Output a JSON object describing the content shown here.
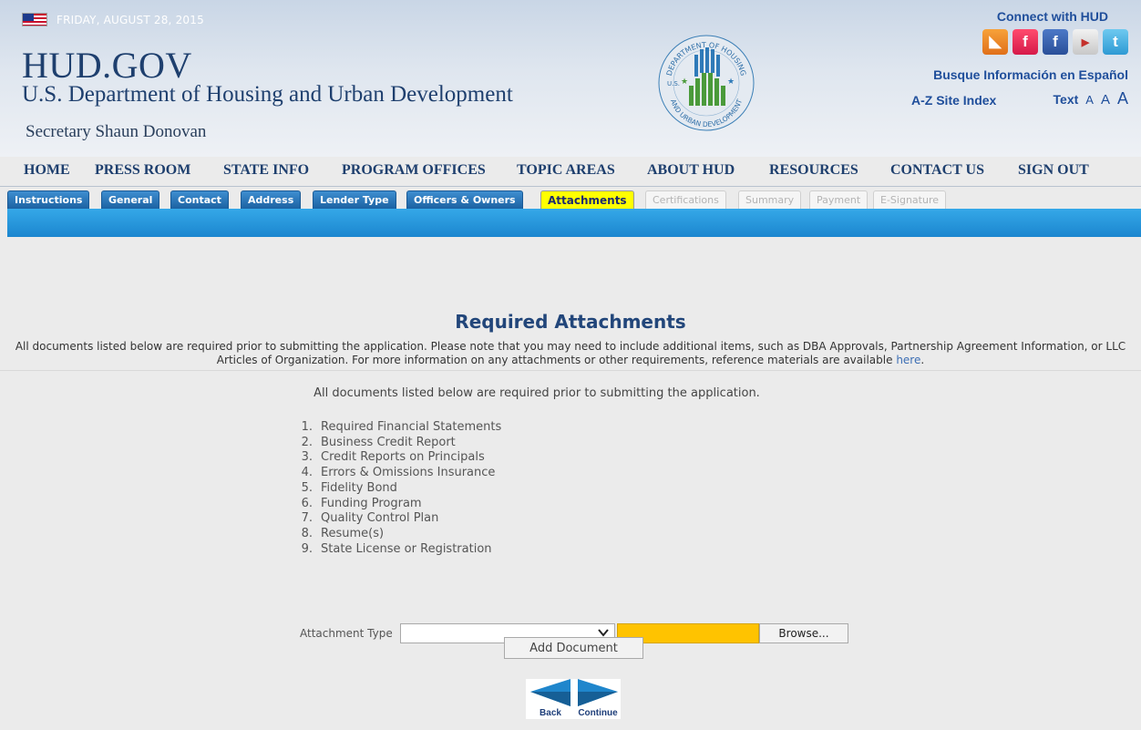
{
  "header": {
    "date": "FRIDAY, AUGUST 28, 2015",
    "site": "HUD.GOV",
    "department": "U.S. Department of Housing and Urban Development",
    "secretary": "Secretary Shaun Donovan",
    "connect": "Connect with HUD",
    "spanish": "Busque Información en Español",
    "az_index": "A-Z Site Index",
    "text_label": "Text",
    "text_sizes": [
      "A",
      "A",
      "A"
    ],
    "seal_top_text": "DEPARTMENT OF HOUSING",
    "seal_bottom_text": "AND URBAN DEVELOPMENT",
    "seal_left_text": "U.S."
  },
  "nav": [
    "HOME",
    "PRESS ROOM",
    "STATE INFO",
    "PROGRAM OFFICES",
    "TOPIC AREAS",
    "ABOUT HUD",
    "RESOURCES",
    "CONTACT US",
    "SIGN OUT"
  ],
  "tabs": [
    {
      "label": "Instructions",
      "state": "normal"
    },
    {
      "label": "General",
      "state": "normal"
    },
    {
      "label": "Contact",
      "state": "normal"
    },
    {
      "label": "Address",
      "state": "normal"
    },
    {
      "label": "Lender Type",
      "state": "normal"
    },
    {
      "label": "Officers & Owners",
      "state": "normal"
    },
    {
      "label": "Attachments",
      "state": "active"
    },
    {
      "label": "Certifications",
      "state": "disabled"
    },
    {
      "label": "Summary",
      "state": "disabled"
    },
    {
      "label": "Payment",
      "state": "disabled"
    },
    {
      "label": "E-Signature",
      "state": "disabled"
    }
  ],
  "main": {
    "title": "Required Attachments",
    "intro": "All documents listed below are required prior to submitting the application. Please note that you may need to include additional items, such as DBA Approvals, Partnership Agreement Information, or LLC Articles of Organization. For more information on any attachments or other requirements, reference materials are available",
    "intro_link": "here",
    "intro_end": ".",
    "subtitle": "All documents listed below are required prior to submitting the application.",
    "documents": [
      "Required Financial Statements",
      "Business Credit Report",
      "Credit Reports on Principals",
      "Errors & Omissions Insurance",
      "Fidelity Bond",
      "Funding Program",
      "Quality Control Plan",
      "Resume(s)",
      "State License or Registration"
    ],
    "attachment_type_label": "Attachment Type",
    "attachment_type_value": "",
    "browse_label": "Browse...",
    "add_document_label": "Add Document",
    "back_label": "Back",
    "continue_label": "Continue"
  },
  "colors": {
    "brand_navy": "#1e3f6e",
    "tab_blue": "#1a5f9f",
    "active_tab": "#ffff00",
    "file_field": "#ffc300",
    "bar_blue": "#1b86cf"
  }
}
